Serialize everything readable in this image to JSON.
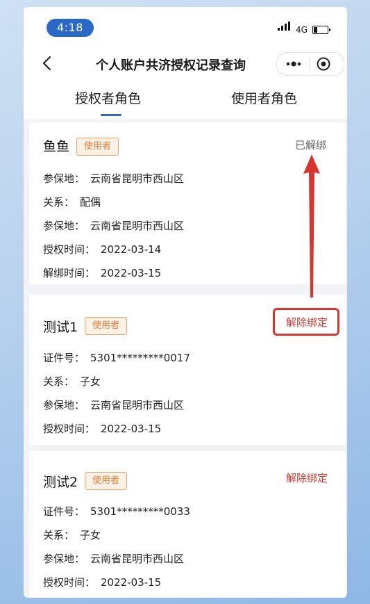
{
  "status_bar": {
    "time": "4:18",
    "network": "4G"
  },
  "nav": {
    "title": "个人账户共济授权记录查询"
  },
  "tabs": [
    {
      "label": "授权者角色"
    },
    {
      "label": "使用者角色"
    }
  ],
  "records": [
    {
      "name": "鱼鱼",
      "badge": "使用者",
      "status": "已解绑",
      "fields": [
        {
          "label": "参保地：",
          "value": "云南省昆明市西山区"
        },
        {
          "label": "关系：",
          "value": "配偶"
        },
        {
          "label": "参保地：",
          "value": "云南省昆明市西山区"
        },
        {
          "label": "授权时间：",
          "value": "2022-03-14"
        },
        {
          "label": "解绑时间：",
          "value": "2022-03-15"
        }
      ]
    },
    {
      "name": "测试1",
      "badge": "使用者",
      "action": "解除绑定",
      "fields": [
        {
          "label": "证件号：",
          "value": "5301*********0017"
        },
        {
          "label": "关系：",
          "value": "子女"
        },
        {
          "label": "参保地：",
          "value": "云南省昆明市西山区"
        },
        {
          "label": "授权时间：",
          "value": "2022-03-15"
        }
      ]
    },
    {
      "name": "测试2",
      "badge": "使用者",
      "action": "解除绑定",
      "fields": [
        {
          "label": "证件号：",
          "value": "5301*********0033"
        },
        {
          "label": "关系：",
          "value": "子女"
        },
        {
          "label": "参保地：",
          "value": "云南省昆明市西山区"
        },
        {
          "label": "授权时间：",
          "value": "2022-03-15"
        }
      ]
    }
  ],
  "colors": {
    "accent": "#2a69c8",
    "danger": "#d9352f",
    "badge_border": "#e8a26a",
    "badge_bg": "#fdf0e4",
    "badge_text": "#e0823c"
  },
  "icons": [
    "back-icon",
    "more-icon",
    "target-icon",
    "signal-icon",
    "battery-icon",
    "arrow-annotation"
  ]
}
